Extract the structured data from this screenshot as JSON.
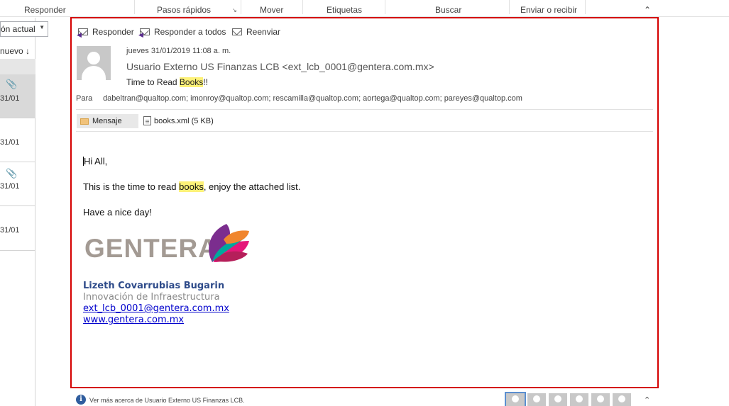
{
  "ribbon": {
    "groups": [
      "Responder",
      "Pasos rápidos",
      "Mover",
      "Etiquetas",
      "Buscar",
      "Enviar o recibir"
    ],
    "collapse_glyph": "⌃",
    "launcher_glyph": "↘"
  },
  "message_list": {
    "view_label": "ón actual",
    "sort_label": "nuevo ↓",
    "items": [
      {
        "date": "31/01",
        "attachment": true,
        "selected": true
      },
      {
        "date": "31/01",
        "attachment": false,
        "selected": false
      },
      {
        "date": "31/01",
        "attachment": true,
        "selected": false
      },
      {
        "date": "31/01",
        "attachment": false,
        "selected": false
      }
    ]
  },
  "reading_pane": {
    "actions": {
      "reply": "Responder",
      "reply_all": "Responder a todos",
      "forward": "Reenviar"
    },
    "date": "jueves 31/01/2019 11:08 a. m.",
    "sender": "Usuario Externo US Finanzas LCB <ext_lcb_0001@gentera.com.mx>",
    "subject_prefix": "Time to Read ",
    "subject_highlight": "Books",
    "subject_suffix": "!!",
    "to_label": "Para",
    "recipients": "dabeltran@qualtop.com; imonroy@qualtop.com; rescamilla@qualtop.com; aortega@qualtop.com; pareyes@qualtop.com",
    "attachments": {
      "message_tab": "Mensaje",
      "file": "books.xml (5 KB)"
    },
    "body": {
      "greeting": "Hi All,",
      "line2_prefix": "This is the time to read ",
      "line2_highlight": "books",
      "line2_suffix": ", enjoy the attached list.",
      "line3": "Have a nice day!"
    },
    "signature": {
      "logo_text": "GENTERA",
      "name": "Lizeth Covarrubias Bugarin",
      "role": "Innovación de Infraestructura",
      "email": "ext_lcb_0001@gentera.com.mx",
      "website": "www.gentera.com.mx"
    }
  },
  "people_pane": {
    "info_glyph": "i",
    "text": "Ver más acerca de Usuario Externo US Finanzas LCB.",
    "avatar_count": 6,
    "collapse_glyph": "⌃"
  },
  "colors": {
    "highlight": "#fdf178",
    "frame": "#d40000",
    "signature_name": "#2e4b8a",
    "link": "#0000cc"
  }
}
